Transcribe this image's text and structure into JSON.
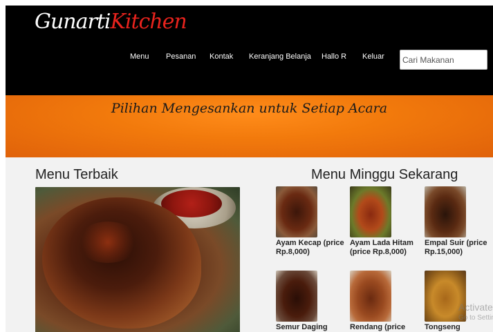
{
  "brand": {
    "part1": "Gunarti",
    "part2": "Kitchen"
  },
  "nav": {
    "items": [
      {
        "label": "Menu"
      },
      {
        "label": "Pesanan"
      },
      {
        "label": "Kontak"
      },
      {
        "label": "Keranjang Belanja"
      },
      {
        "label": "Hallo R"
      },
      {
        "label": "Keluar"
      }
    ]
  },
  "search": {
    "placeholder": "Cari Makanan",
    "value": ""
  },
  "banner": {
    "tagline": "Pilihan Mengesankan untuk Setiap Acara"
  },
  "best_menu": {
    "heading": "Menu Terbaik"
  },
  "weekly_menu": {
    "heading": "Menu Minggu Sekarang",
    "items": [
      {
        "name": "Ayam Kecap (price Rp.8,000)"
      },
      {
        "name": "Ayam Lada Hitam (price Rp.8,000)"
      },
      {
        "name": "Empal Suir (price Rp.15,000)"
      },
      {
        "name": "Semur Daging"
      },
      {
        "name": "Rendang (price"
      },
      {
        "name": "Tongseng"
      }
    ]
  },
  "watermark": {
    "line1": "Activate V",
    "line2": "Go to Setting"
  },
  "colors": {
    "header_bg": "#000000",
    "brand_accent": "#e8231d",
    "banner_orange": "#f27a0c",
    "content_bg": "#f2f2f2"
  }
}
